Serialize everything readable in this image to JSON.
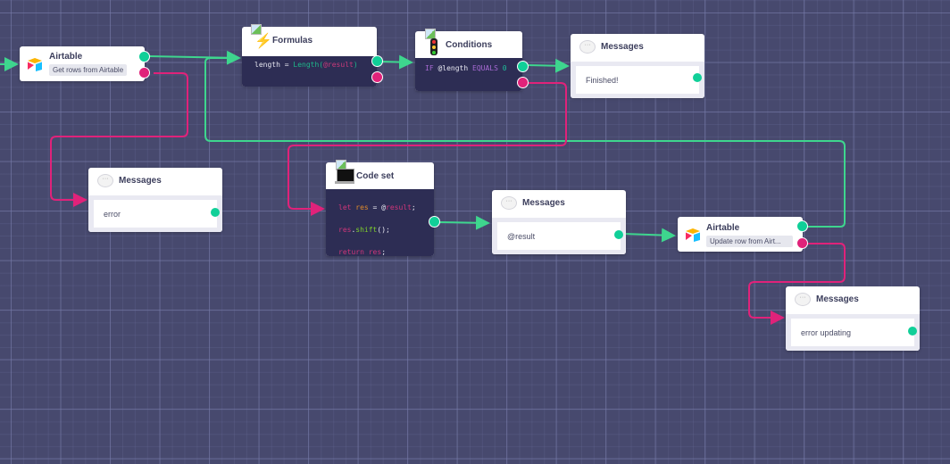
{
  "nodes": {
    "airtable_get": {
      "title": "Airtable",
      "subtitle": "Get rows from Airtable",
      "icon": "airtable-logo-icon"
    },
    "formulas": {
      "title": "Formulas",
      "icon": "lightning-icon",
      "code": {
        "lhs": "length",
        "op": "=",
        "fn": "Length(",
        "arg": "@result",
        "close": ")"
      }
    },
    "conditions": {
      "title": "Conditions",
      "icon": "traffic-light-icon",
      "code": {
        "kw1": "IF",
        "var": "@length",
        "kw2": "EQUALS",
        "num": "0"
      }
    },
    "msg_finished": {
      "title": "Messages",
      "text": "Finished!",
      "icon": "speech-bubble-icon"
    },
    "msg_error": {
      "title": "Messages",
      "text": "error",
      "icon": "speech-bubble-icon"
    },
    "code_set": {
      "title": "Code set",
      "icon": "laptop-icon",
      "lines": [
        {
          "a": "let",
          "b": "res",
          "c": " = @",
          "d": "result",
          "e": ";"
        },
        {
          "a": "res",
          "b": ".",
          "c": "shift",
          "d": "();",
          "e": ""
        },
        {
          "a": "return",
          "b": " ",
          "c": "res",
          "d": ";",
          "e": ""
        }
      ]
    },
    "msg_result": {
      "title": "Messages",
      "text": "@result",
      "icon": "speech-bubble-icon"
    },
    "airtable_update": {
      "title": "Airtable",
      "subtitle": "Update row from Airt...",
      "icon": "airtable-logo-icon"
    },
    "msg_error_updating": {
      "title": "Messages",
      "text": "error updating",
      "icon": "speech-bubble-icon"
    }
  },
  "colors": {
    "success": "#10cf98",
    "error": "#e0227a",
    "canvas": "#47496e",
    "code_bg": "#2d2d54"
  }
}
